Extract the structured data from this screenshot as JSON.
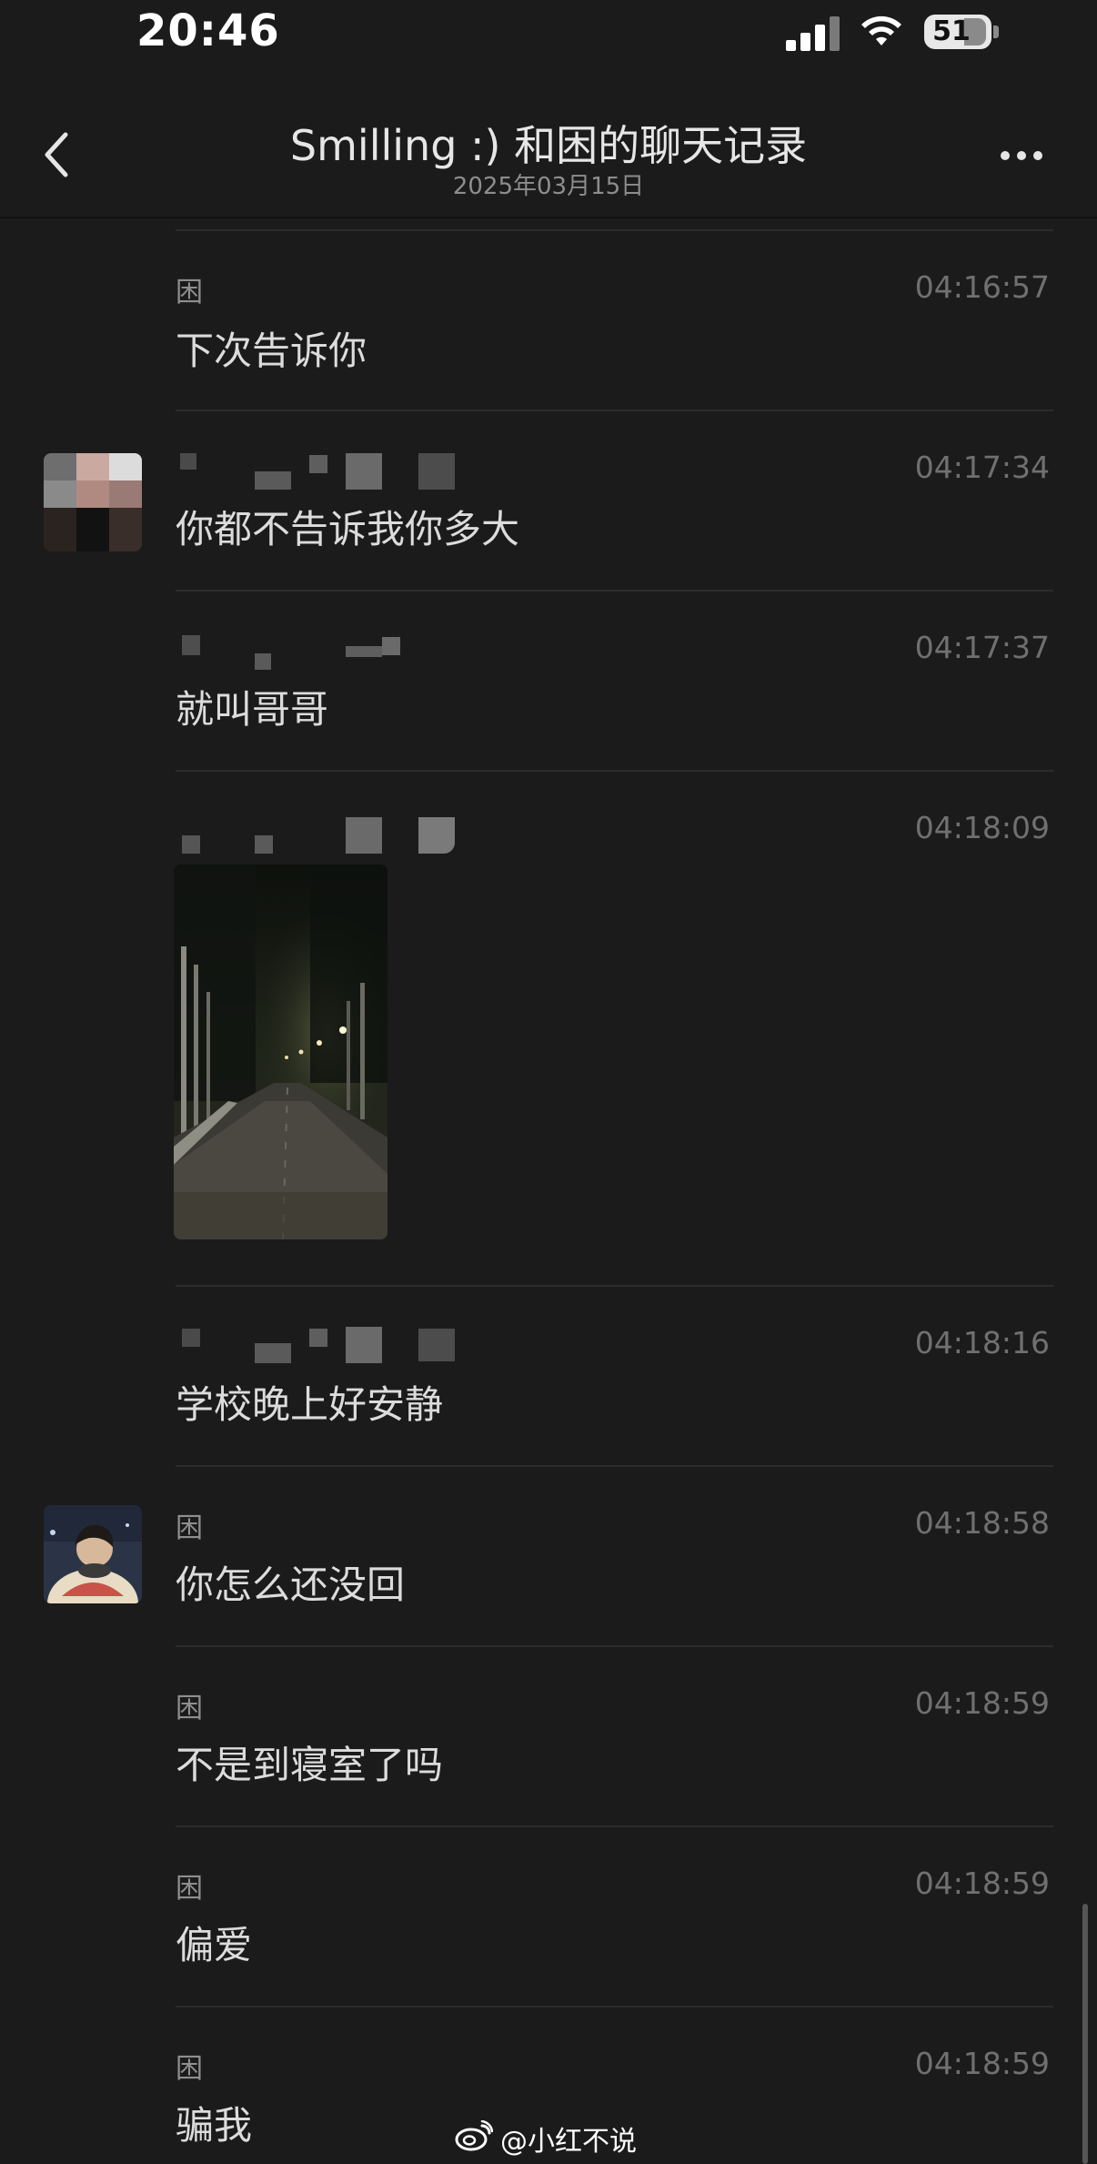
{
  "status_bar": {
    "time": "20:46",
    "battery": "51"
  },
  "header": {
    "title": "Smilling :) 和困的聊天记录",
    "date": "2025年03月15日"
  },
  "messages": [
    {
      "sender": "困",
      "time": "04:16:57",
      "text": "下次告诉你"
    },
    {
      "sender": "",
      "time": "04:17:34",
      "text": "你都不告诉我你多大"
    },
    {
      "sender": "",
      "time": "04:17:37",
      "text": "就叫哥哥"
    },
    {
      "sender": "",
      "time": "04:18:09",
      "text": ""
    },
    {
      "sender": "",
      "time": "04:18:16",
      "text": "学校晚上好安静"
    },
    {
      "sender": "困",
      "time": "04:18:58",
      "text": "你怎么还没回"
    },
    {
      "sender": "困",
      "time": "04:18:59",
      "text": "不是到寝室了吗"
    },
    {
      "sender": "困",
      "time": "04:18:59",
      "text": "偏爱"
    },
    {
      "sender": "困",
      "time": "04:18:59",
      "text": "骗我"
    }
  ],
  "watermark": "@小红不说",
  "icons": {
    "back": "chevron-left-icon",
    "more": "more-dots-icon",
    "signal": "cellular-signal-icon",
    "wifi": "wifi-icon",
    "battery": "battery-icon",
    "watermark": "weibo-logo-icon"
  },
  "colors": {
    "background": "#1b1b1b",
    "text": "#dcdcdc",
    "muted": "#707070"
  }
}
